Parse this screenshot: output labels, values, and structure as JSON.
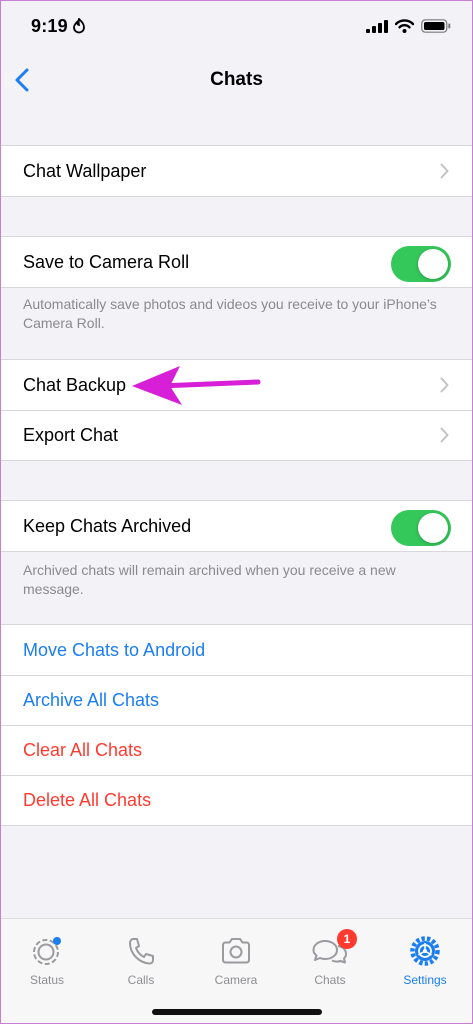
{
  "status_bar": {
    "time": "9:19"
  },
  "nav": {
    "title": "Chats",
    "back_icon": "chevron-left-icon"
  },
  "settings": {
    "chat_wallpaper": "Chat Wallpaper",
    "save_to_camera_roll": {
      "label": "Save to Camera Roll",
      "on": true
    },
    "save_note": "Automatically save photos and videos you receive to your iPhone’s Camera Roll.",
    "chat_backup": "Chat Backup",
    "export_chat": "Export Chat",
    "keep_archived": {
      "label": "Keep Chats Archived",
      "on": true
    },
    "archived_note": "Archived chats will remain archived when you receive a new message.",
    "move_to_android": "Move Chats to Android",
    "archive_all": "Archive All Chats",
    "clear_all": "Clear All Chats",
    "delete_all": "Delete All Chats"
  },
  "annotation": {
    "arrow_color": "#d61fd6"
  },
  "colors": {
    "toggle_on": "#34c759",
    "link_blue": "#1a7ef2",
    "destructive_red": "#ff3b30"
  },
  "tabs": [
    {
      "label": "Status",
      "icon": "status-icon"
    },
    {
      "label": "Calls",
      "icon": "phone-icon"
    },
    {
      "label": "Camera",
      "icon": "camera-icon"
    },
    {
      "label": "Chats",
      "icon": "chat-bubbles-icon",
      "badge": "1"
    },
    {
      "label": "Settings",
      "icon": "gear-icon",
      "active": true
    }
  ]
}
